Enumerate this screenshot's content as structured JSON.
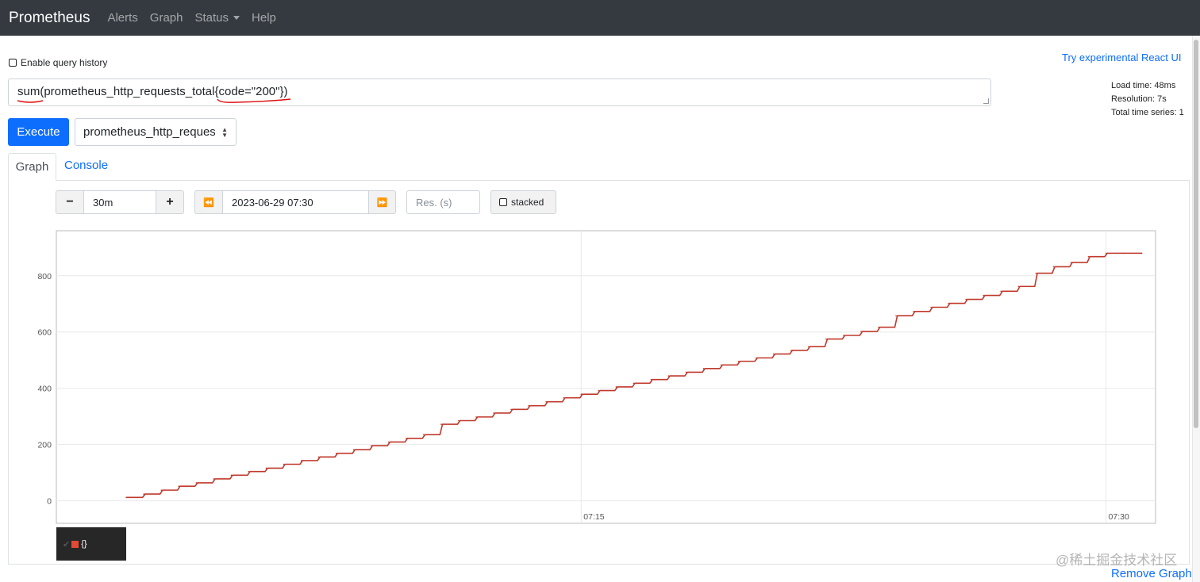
{
  "navbar": {
    "brand": "Prometheus",
    "links": [
      "Alerts",
      "Graph",
      "Status",
      "Help"
    ]
  },
  "query_history_label": "Enable query history",
  "react_ui_link": "Try experimental React UI",
  "query": {
    "func": "sum",
    "open": "(",
    "metric": "prometheus_http_requests_total",
    "label_matcher": "{code=\"200\"}",
    "close": ")"
  },
  "stats": {
    "load_time": "Load time: 48ms",
    "resolution": "Resolution: 7s",
    "total_series": "Total time series: 1"
  },
  "execute_label": "Execute",
  "metric_select_value": "prometheus_http_requests_total",
  "tabs": {
    "graph": "Graph",
    "console": "Console"
  },
  "controls": {
    "range_value": "30m",
    "end_time_value": "2023-06-29 07:30",
    "resolution_placeholder": "Res. (s)",
    "stacked_label": "stacked",
    "minus_icon": "−",
    "plus_icon": "+",
    "back_icon": "⏪",
    "forward_icon": "⏩"
  },
  "legend_label": "{}",
  "watermark": "@稀土掘金技术社区",
  "remove_graph": "Remove Graph",
  "colors": {
    "series": "#c0392b",
    "accent": "#0d6efd",
    "navbar": "#343a40"
  },
  "chart_data": {
    "type": "line",
    "xlabel": "",
    "ylabel": "",
    "xticks": [
      "07:15",
      "07:30"
    ],
    "yticks": [
      0,
      200,
      400,
      600,
      800
    ],
    "ylim": [
      -80,
      960
    ],
    "grid": true,
    "series": [
      {
        "name": "{}",
        "step": true,
        "x": [
          "07:02",
          "07:02:30",
          "07:03",
          "07:03:30",
          "07:04",
          "07:04:30",
          "07:05",
          "07:05:30",
          "07:06",
          "07:06:30",
          "07:07",
          "07:07:30",
          "07:08",
          "07:08:30",
          "07:09",
          "07:09:30",
          "07:10",
          "07:10:30",
          "07:11",
          "07:11:30",
          "07:12",
          "07:12:30",
          "07:13",
          "07:13:30",
          "07:14",
          "07:14:30",
          "07:15",
          "07:15:30",
          "07:16",
          "07:16:30",
          "07:17",
          "07:17:30",
          "07:18",
          "07:18:30",
          "07:19",
          "07:19:30",
          "07:20",
          "07:20:30",
          "07:21",
          "07:21:30",
          "07:22",
          "07:22:30",
          "07:23",
          "07:23:30",
          "07:24",
          "07:24:30",
          "07:25",
          "07:25:30",
          "07:26",
          "07:26:30",
          "07:27",
          "07:27:30",
          "07:28",
          "07:28:30",
          "07:29",
          "07:29:30",
          "07:30",
          "07:30:30",
          "07:31"
        ],
        "values": [
          12,
          24,
          38,
          52,
          64,
          78,
          91,
          104,
          116,
          130,
          143,
          156,
          169,
          182,
          196,
          209,
          222,
          235,
          272,
          285,
          298,
          312,
          325,
          338,
          352,
          366,
          379,
          392,
          405,
          418,
          431,
          444,
          457,
          470,
          483,
          496,
          508,
          522,
          535,
          548,
          575,
          588,
          602,
          617,
          658,
          673,
          688,
          702,
          716,
          730,
          745,
          762,
          809,
          832,
          847,
          868,
          880,
          880,
          880
        ]
      }
    ]
  }
}
